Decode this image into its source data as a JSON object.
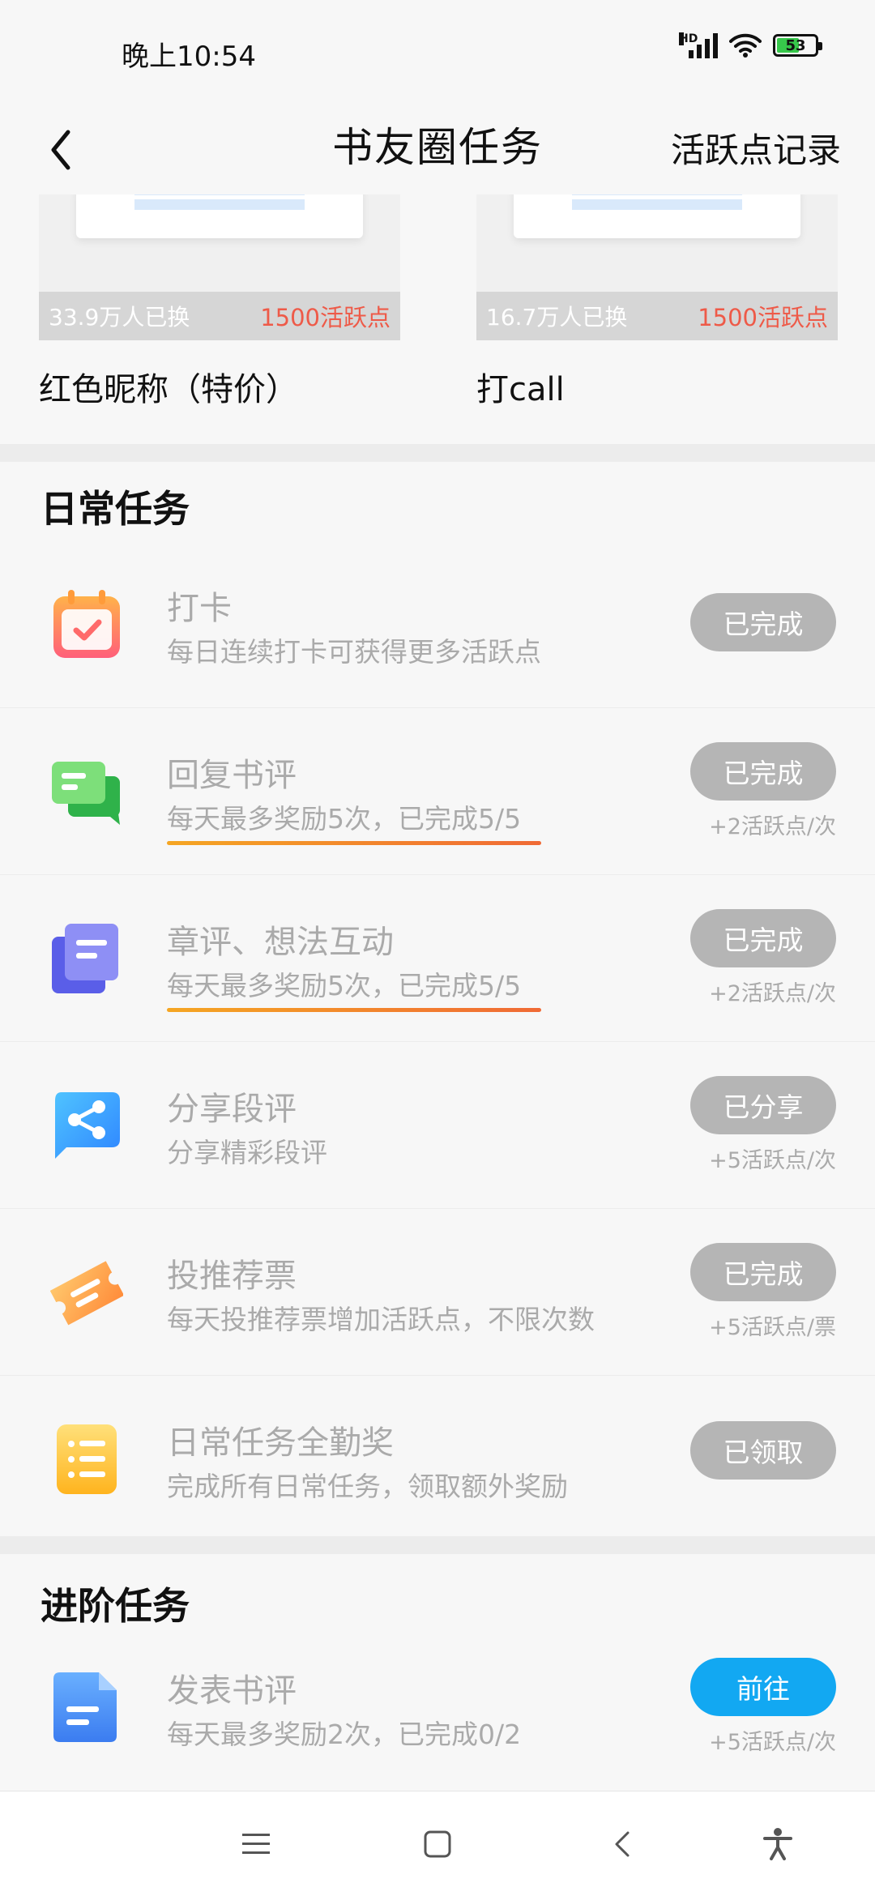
{
  "status_bar": {
    "time": "晚上10:54",
    "battery_level": "53",
    "network": "HD"
  },
  "header": {
    "title": "书友圈任务",
    "right_link": "活跃点记录"
  },
  "exchange_items": [
    {
      "exchanged": "33.9万人已换",
      "cost": "1500活跃点",
      "name": "红色昵称（特价）"
    },
    {
      "exchanged": "16.7万人已换",
      "cost": "1500活跃点",
      "name": "打call"
    }
  ],
  "daily_section": {
    "title": "日常任务",
    "tasks": [
      {
        "title": "打卡",
        "desc": "每日连续打卡可获得更多活跃点",
        "button": "已完成",
        "reward": "",
        "icon": "calendar-check-icon"
      },
      {
        "title": "回复书评",
        "desc": "每天最多奖励5次，已完成5/5",
        "button": "已完成",
        "reward": "+2活跃点/次",
        "icon": "chat-bubbles-icon"
      },
      {
        "title": "章评、想法互动",
        "desc": "每天最多奖励5次，已完成5/5",
        "button": "已完成",
        "reward": "+2活跃点/次",
        "icon": "stacked-cards-icon"
      },
      {
        "title": "分享段评",
        "desc": "分享精彩段评",
        "button": "已分享",
        "reward": "+5活跃点/次",
        "icon": "share-icon"
      },
      {
        "title": "投推荐票",
        "desc": "每天投推荐票增加活跃点，不限次数",
        "button": "已完成",
        "reward": "+5活跃点/票",
        "icon": "ticket-icon"
      },
      {
        "title": "日常任务全勤奖",
        "desc": "完成所有日常任务，领取额外奖励",
        "button": "已领取",
        "reward": "",
        "icon": "list-icon"
      }
    ]
  },
  "advanced_section": {
    "title": "进阶任务",
    "tasks": [
      {
        "title": "发表书评",
        "desc": "每天最多奖励2次，已完成0/2",
        "button": "前往",
        "reward": "+5活跃点/次",
        "icon": "document-icon"
      }
    ]
  },
  "colors": {
    "accent": "#12a8f2",
    "done_button": "#b5b5b5",
    "cost_red": "#ee5a48",
    "underline_start": "#f5a623",
    "underline_end": "#f06a35"
  }
}
